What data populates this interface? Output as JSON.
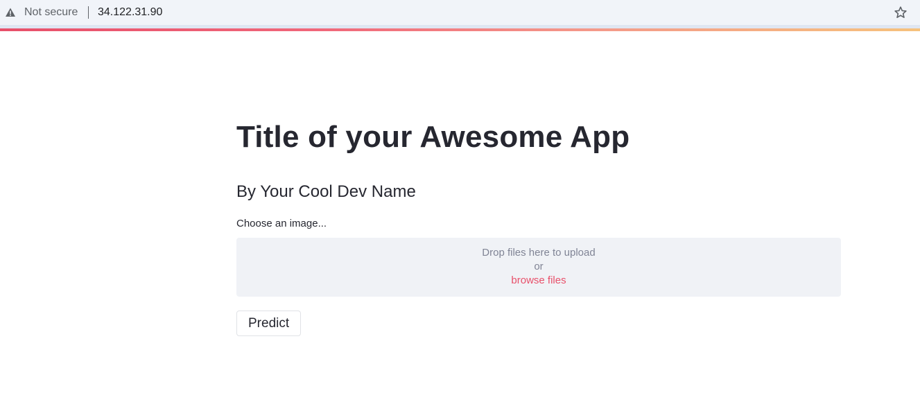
{
  "browser": {
    "security_label": "Not secure",
    "url": "34.122.31.90",
    "icons": {
      "warning": "warning-triangle-icon",
      "bookmark": "star-icon"
    }
  },
  "app": {
    "title": "Title of your Awesome App",
    "subtitle": "By Your Cool Dev Name",
    "accent_color": "#e8506a",
    "uploader": {
      "label": "Choose an image...",
      "drop_text": "Drop files here to upload",
      "or_text": "or",
      "browse_text": "browse files"
    },
    "predict_label": "Predict"
  }
}
